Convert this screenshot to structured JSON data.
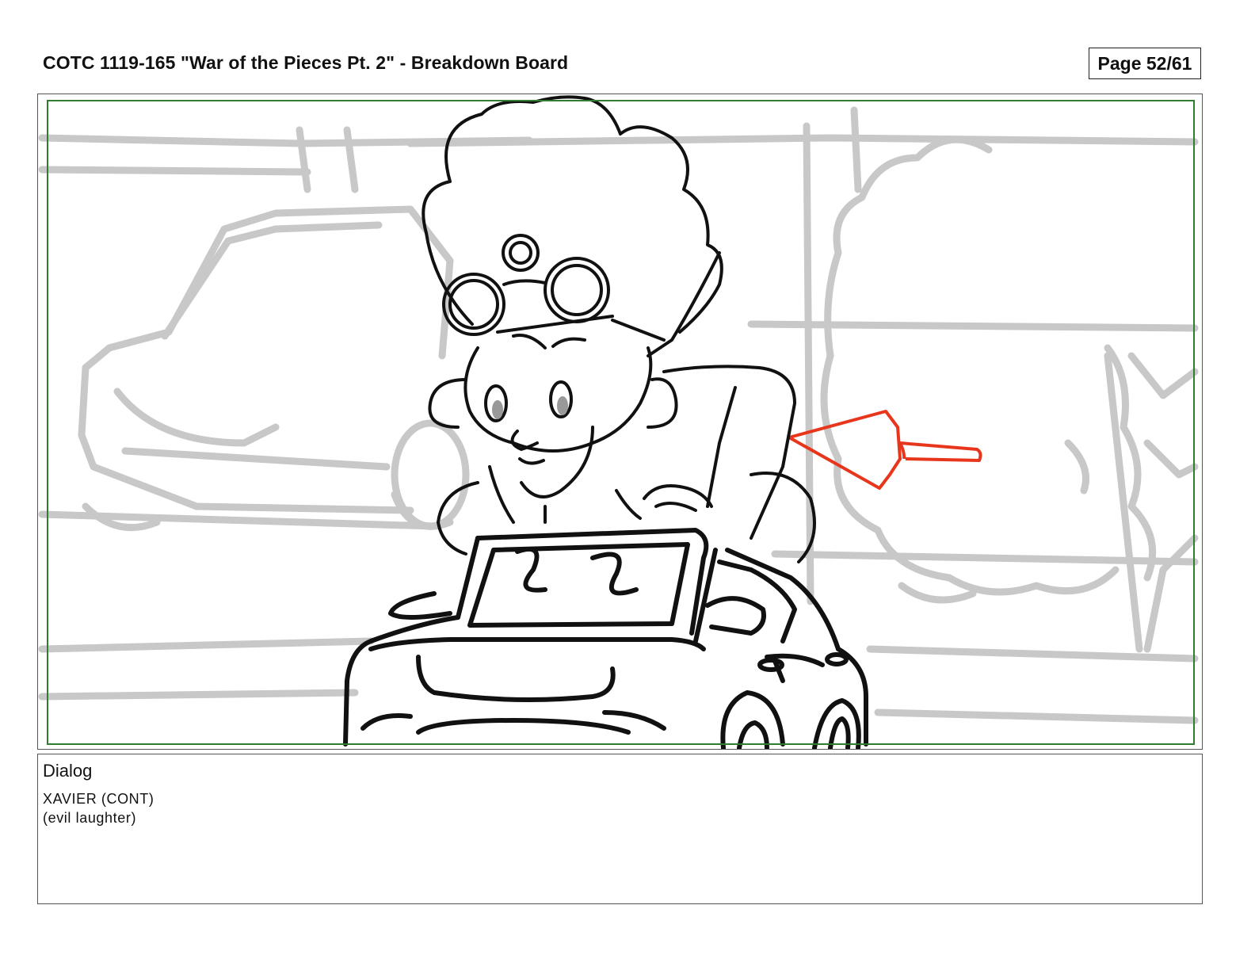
{
  "header": {
    "title": "COTC 1119-165 \"War of the Pieces Pt. 2\" - Breakdown Board",
    "page_label": "Page 52/61"
  },
  "panel": {
    "safe_frame_color": "#2f7d2f",
    "background_sketch_color": "#c8c8c8",
    "character_line_color": "#111111",
    "arrow_color": "#e8361c"
  },
  "dialog": {
    "heading": "Dialog",
    "lines": [
      "XAVIER (CONT)",
      "(evil laughter)"
    ]
  }
}
